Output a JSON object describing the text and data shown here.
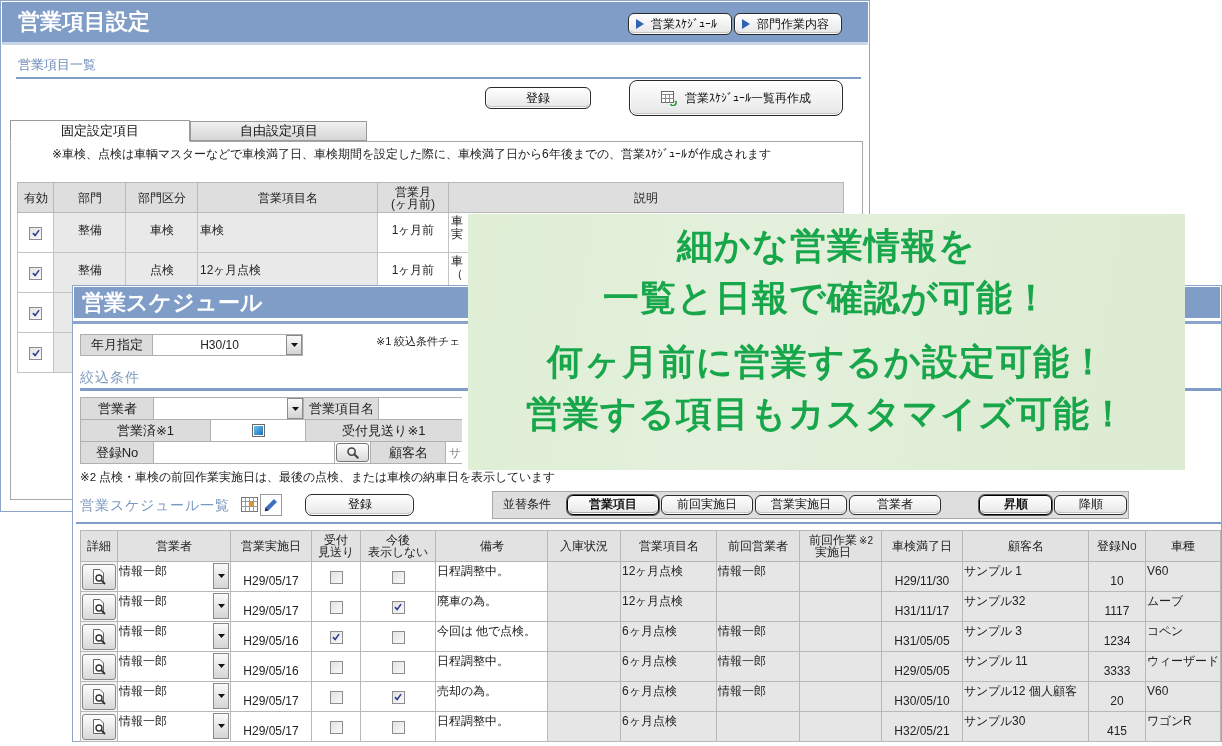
{
  "settings_window": {
    "title": "営業項目設定",
    "nav_buttons": [
      "営業ｽｹｼﾞｭｰﾙ",
      "部門作業内容"
    ],
    "section_title": "営業項目一覧",
    "register_button": "登録",
    "rebuild_button": "営業ｽｹｼﾞｭｰﾙ一覧再作成",
    "tabs": [
      {
        "label": "固定設定項目",
        "selected": true
      },
      {
        "label": "自由設定項目",
        "selected": false
      }
    ],
    "note": "※車検、点検は車輌マスターなどで車検満了日、車検期間を設定した際に、車検満了日から6年後までの、営業ｽｹｼﾞｭｰﾙが作成されます",
    "table": {
      "columns": [
        "有効",
        "部門",
        "部門区分",
        "営業項目名",
        "営業月(ヶ月前)",
        "説明"
      ],
      "rows": [
        {
          "enabled": true,
          "department": "整備",
          "category": "車検",
          "item": "車検",
          "months": "1ヶ月前",
          "description": [
            "車",
            "実"
          ]
        },
        {
          "enabled": true,
          "department": "整備",
          "category": "点検",
          "item": "12ヶ月点検",
          "months": "1ヶ月前",
          "description": [
            "車",
            "（"
          ]
        },
        {
          "enabled": true
        },
        {
          "enabled": true
        }
      ]
    }
  },
  "schedule_window": {
    "title": "営業スケジュール",
    "period": {
      "label": "年月指定",
      "value": "H30/10"
    },
    "note_1": "※1 絞込条件チェ",
    "filter_title": "絞込条件",
    "filters": {
      "staff_label": "営業者",
      "item_label": "営業項目名",
      "done": {
        "label": "営業済※1",
        "indeterminate": true
      },
      "skip_label": "受付見送り※1",
      "reg_label": "登録No",
      "customer_label": "顧客名",
      "customer_placeholder": "サ"
    },
    "note_2": "※2 点検・車検の前回作業実施日は、最後の点検、または車検の納車日を表示しています",
    "list_title": "営業スケジュール一覧",
    "register_button": "登録",
    "sort": {
      "label": "並替条件",
      "keys": [
        {
          "label": "営業項目",
          "selected": true
        },
        {
          "label": "前回実施日",
          "selected": false
        },
        {
          "label": "営業実施日",
          "selected": false
        },
        {
          "label": "営業者",
          "selected": false
        }
      ],
      "orders": [
        {
          "label": "昇順",
          "selected": true
        },
        {
          "label": "降順",
          "selected": false
        }
      ]
    },
    "table": {
      "columns": [
        {
          "label": "詳細",
          "kind": "detail"
        },
        {
          "label": "営業者",
          "kind": "staff"
        },
        {
          "label": "営業実施日",
          "kind": "date"
        },
        {
          "label": "受付見送り",
          "kind": "declined"
        },
        {
          "label": "今後表示しない",
          "kind": "hidden"
        },
        {
          "label": "備考",
          "kind": "remarks"
        },
        {
          "label": "入庫状況",
          "kind": "arrival"
        },
        {
          "label": "営業項目名",
          "kind": "item"
        },
        {
          "label": "前回営業者",
          "kind": "previous_staff"
        },
        {
          "label": "前回作業実施日",
          "note": "※2",
          "kind": "previous_date"
        },
        {
          "label": "車検満了日",
          "kind": "expiry"
        },
        {
          "label": "顧客名",
          "kind": "customer"
        },
        {
          "label": "登録No",
          "kind": "reg_no"
        },
        {
          "label": "車種",
          "kind": "model"
        }
      ],
      "rows": [
        {
          "staff": "情報一郎",
          "date": "H29/05/17",
          "declined": false,
          "hidden": false,
          "remarks": "日程調整中。",
          "item": "12ヶ月点検",
          "previous_staff": "情報一郎",
          "expiry": "H29/11/30",
          "customer": "サンプル 1",
          "reg_no": "10",
          "model": "V60"
        },
        {
          "staff": "情報一郎",
          "date": "H29/05/17",
          "declined": false,
          "hidden": true,
          "remarks": "廃車の為。",
          "item": "12ヶ月点検",
          "expiry": "H31/11/17",
          "customer": "サンプル32",
          "reg_no": "1117",
          "model": "ムーブ"
        },
        {
          "staff": "情報一郎",
          "date": "H29/05/16",
          "declined": true,
          "hidden": false,
          "remarks": "今回は 他で点検。",
          "item": "6ヶ月点検",
          "previous_staff": "情報一郎",
          "expiry": "H31/05/05",
          "customer": "サンプル 3",
          "reg_no": "1234",
          "model": "コペン"
        },
        {
          "staff": "情報一郎",
          "date": "H29/05/16",
          "declined": false,
          "hidden": false,
          "remarks": "日程調整中。",
          "item": "6ヶ月点検",
          "previous_staff": "情報一郎",
          "expiry": "H29/05/05",
          "customer": "サンプル 11",
          "reg_no": "3333",
          "model": "ウィーザード"
        },
        {
          "staff": "情報一郎",
          "date": "H29/05/17",
          "declined": false,
          "hidden": true,
          "remarks": "売却の為。",
          "item": "6ヶ月点検",
          "previous_staff": "情報一郎",
          "expiry": "H30/05/10",
          "customer": "サンプル12 個人顧客",
          "reg_no": "20",
          "model": "V60"
        },
        {
          "staff": "情報一郎",
          "date": "H29/05/17",
          "declined": false,
          "hidden": false,
          "remarks": "日程調整中。",
          "item": "6ヶ月点検",
          "expiry": "H32/05/21",
          "customer": "サンプル30",
          "reg_no": "415",
          "model": "ワゴンR"
        }
      ]
    }
  },
  "callout": {
    "headline": [
      "細かな営業情報を",
      "一覧と日報で確認が可能！"
    ],
    "points": [
      "何ヶ月前に営業するか設定可能！",
      "営業する項目もカスタマイズ可能！"
    ]
  }
}
